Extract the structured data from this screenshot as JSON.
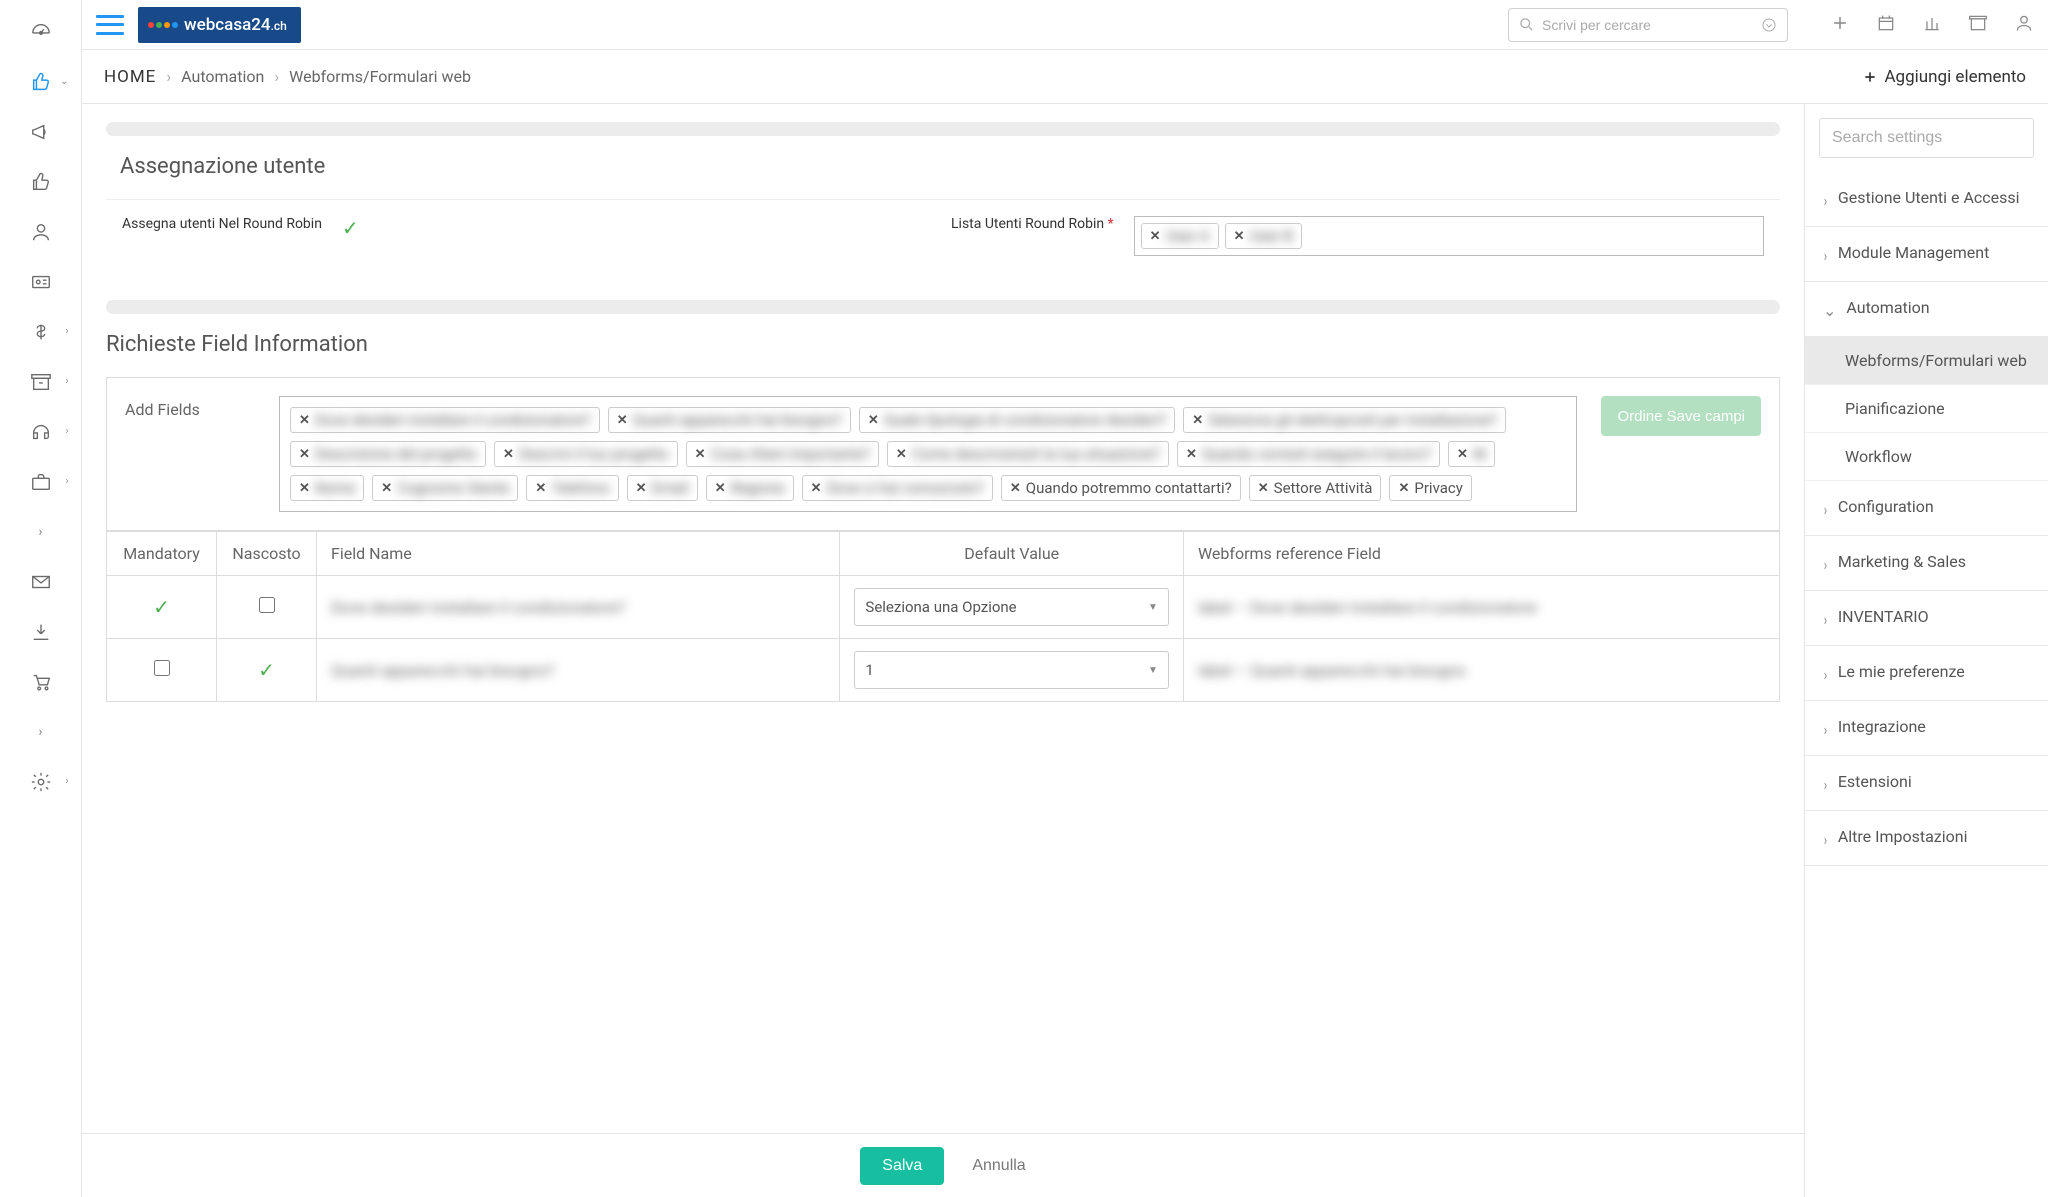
{
  "brand": {
    "name": "webcasa24",
    "tld": ".ch"
  },
  "search": {
    "placeholder": "Scrivi per cercare"
  },
  "breadcrumb": {
    "home": "HOME",
    "path1": "Automation",
    "path2": "Webforms/Formulari web"
  },
  "addElement": "Aggiungi elemento",
  "section1": {
    "title": "Assegnazione utente",
    "assignLabel": "Assegna utenti Nel Round Robin",
    "listLabel": "Lista Utenti Round Robin",
    "users": [
      "User A",
      "User B"
    ]
  },
  "section2": {
    "title": "Richieste Field Information",
    "addFieldsLabel": "Add Fields",
    "orderBtn": "Ordine Save campi",
    "blurTags": [
      "Dove desideri installare il condizionatore?",
      "Quanti apparecchi hai bisogno?",
      "Quale tipologia di condizionatore desideri?",
      "Seleziona gli elettroprosti per installazione?",
      "Descrizione del progetto",
      "Descrivi il tuo progetto",
      "Cosa ritieni importante?",
      "Come descriveresti la tua situazione?",
      "Quando vorresti eseguire il lavoro?",
      "M",
      "Nome",
      "Cognome Utente",
      "Telefono",
      "Email",
      "Regione",
      "Dove ci hai conosciuto?"
    ],
    "clearTags": [
      "Quando potremmo contattarti?",
      "Settore Attività",
      "Privacy"
    ]
  },
  "table": {
    "headers": {
      "mandatory": "Mandatory",
      "hidden": "Nascosto",
      "fieldName": "Field Name",
      "defaultValue": "Default Value",
      "refField": "Webforms reference Field"
    },
    "rows": [
      {
        "mandatory": true,
        "hidden": false,
        "name": "Dove desideri installare il condizionatore?",
        "default": "Seleziona una Opzione",
        "ref": "label – Dove desideri installare il condizionatore"
      },
      {
        "mandatory": false,
        "hidden": true,
        "name": "Quanti apparecchi hai bisogno?",
        "default": "1",
        "ref": "label – Quanti apparecchi hai bisogno"
      }
    ]
  },
  "settings": {
    "searchPlaceholder": "Search settings",
    "items": [
      {
        "label": "Gestione Utenti e Accessi",
        "expanded": false
      },
      {
        "label": "Module Management",
        "expanded": false
      },
      {
        "label": "Automation",
        "expanded": true,
        "children": [
          {
            "label": "Webforms/Formulari web",
            "active": true
          },
          {
            "label": "Pianificazione",
            "active": false
          },
          {
            "label": "Workflow",
            "active": false
          }
        ]
      },
      {
        "label": "Configuration",
        "expanded": false
      },
      {
        "label": "Marketing & Sales",
        "expanded": false
      },
      {
        "label": "INVENTARIO",
        "expanded": false
      },
      {
        "label": "Le mie preferenze",
        "expanded": false
      },
      {
        "label": "Integrazione",
        "expanded": false
      },
      {
        "label": "Estensioni",
        "expanded": false
      },
      {
        "label": "Altre Impostazioni",
        "expanded": false
      }
    ]
  },
  "buttons": {
    "save": "Salva",
    "cancel": "Annulla"
  }
}
